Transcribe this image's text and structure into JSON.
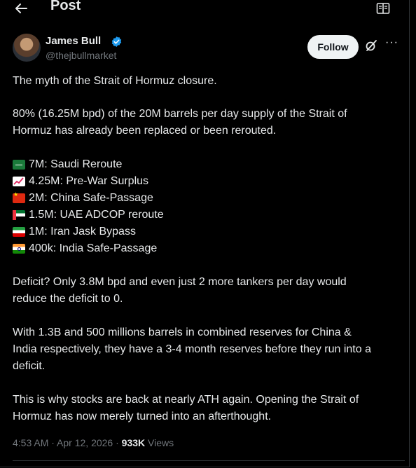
{
  "header": {
    "title": "Post",
    "back_icon": "arrow-left-icon",
    "reader_icon": "reader-mode-icon"
  },
  "author": {
    "name": "James Bull",
    "handle": "@thejbullmarket",
    "verified": true,
    "follow_label": "Follow",
    "grok_icon": "grok-icon",
    "more_label": "···"
  },
  "post": {
    "p1": "The myth of the Strait of Hormuz closure.",
    "p2": "80% (16.25M bpd) of the 20M barrels per day supply of the Strait of\nHormuz has already been replaced or been rerouted.",
    "list": [
      {
        "icon": "saudi-flag-icon",
        "text": "7M: Saudi Reroute"
      },
      {
        "icon": "chart-increasing-icon",
        "text": "4.25M: Pre-War Surplus"
      },
      {
        "icon": "china-flag-icon",
        "text": "2M: China Safe-Passage"
      },
      {
        "icon": "uae-flag-icon",
        "text": "1.5M: UAE ADCOP reroute"
      },
      {
        "icon": "iran-flag-icon",
        "text": "1M: Iran Jask Bypass"
      },
      {
        "icon": "india-flag-icon",
        "text": "400k: India Safe-Passage"
      }
    ],
    "p3": "Deficit? Only 3.8M bpd and even just 2 more tankers per day would\nreduce the deficit to 0.",
    "p4": "With 1.3B and 500 millions barrels in combined reserves for China &\nIndia respectively, they have a 3-4 month reserves before they run into a\ndeficit.",
    "p5": "This is why stocks are back at nearly ATH again. Opening the Strait of\nHormuz has now merely turned into an afterthought."
  },
  "meta": {
    "time": "4:53 AM",
    "sep1": " · ",
    "date": "Apr 12, 2026",
    "sep2": " · ",
    "views": "933K",
    "views_label": " Views"
  },
  "colors": {
    "background": "#000000",
    "text": "#e7e9ea",
    "secondary": "#71767b",
    "verified": "#1d9bf0",
    "follow_bg": "#eff3f4"
  }
}
